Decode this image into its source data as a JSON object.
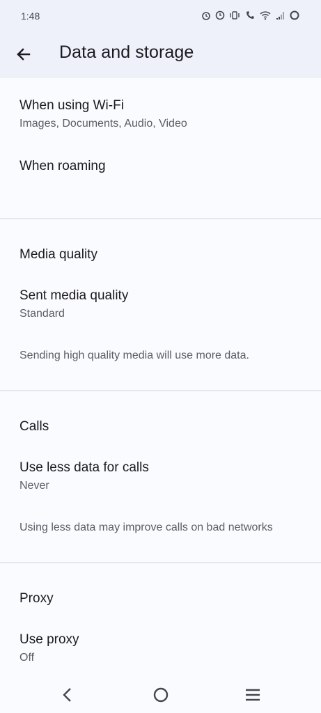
{
  "status": {
    "time": "1:48",
    "icons": [
      "alarm-icon",
      "alarm-clock-icon",
      "vibrate-icon",
      "wifi-call-icon",
      "wifi-icon",
      "signal-icon",
      "battery-saver-icon"
    ]
  },
  "appbar": {
    "title": "Data and storage"
  },
  "sections": {
    "auto_download": {
      "wifi": {
        "title": "When using Wi-Fi",
        "subtitle": "Images, Documents, Audio, Video"
      },
      "roaming": {
        "title": "When roaming"
      }
    },
    "media": {
      "header": "Media quality",
      "sent": {
        "title": "Sent media quality",
        "subtitle": "Standard"
      },
      "note": "Sending high quality media will use more data."
    },
    "calls": {
      "header": "Calls",
      "less_data": {
        "title": "Use less data for calls",
        "subtitle": "Never"
      },
      "note": "Using less data may improve calls on bad networks"
    },
    "proxy": {
      "header": "Proxy",
      "use_proxy": {
        "title": "Use proxy",
        "subtitle": "Off"
      }
    }
  },
  "colors": {
    "appbar_bg": "#eef0fa",
    "page_bg": "#fafbfe"
  }
}
